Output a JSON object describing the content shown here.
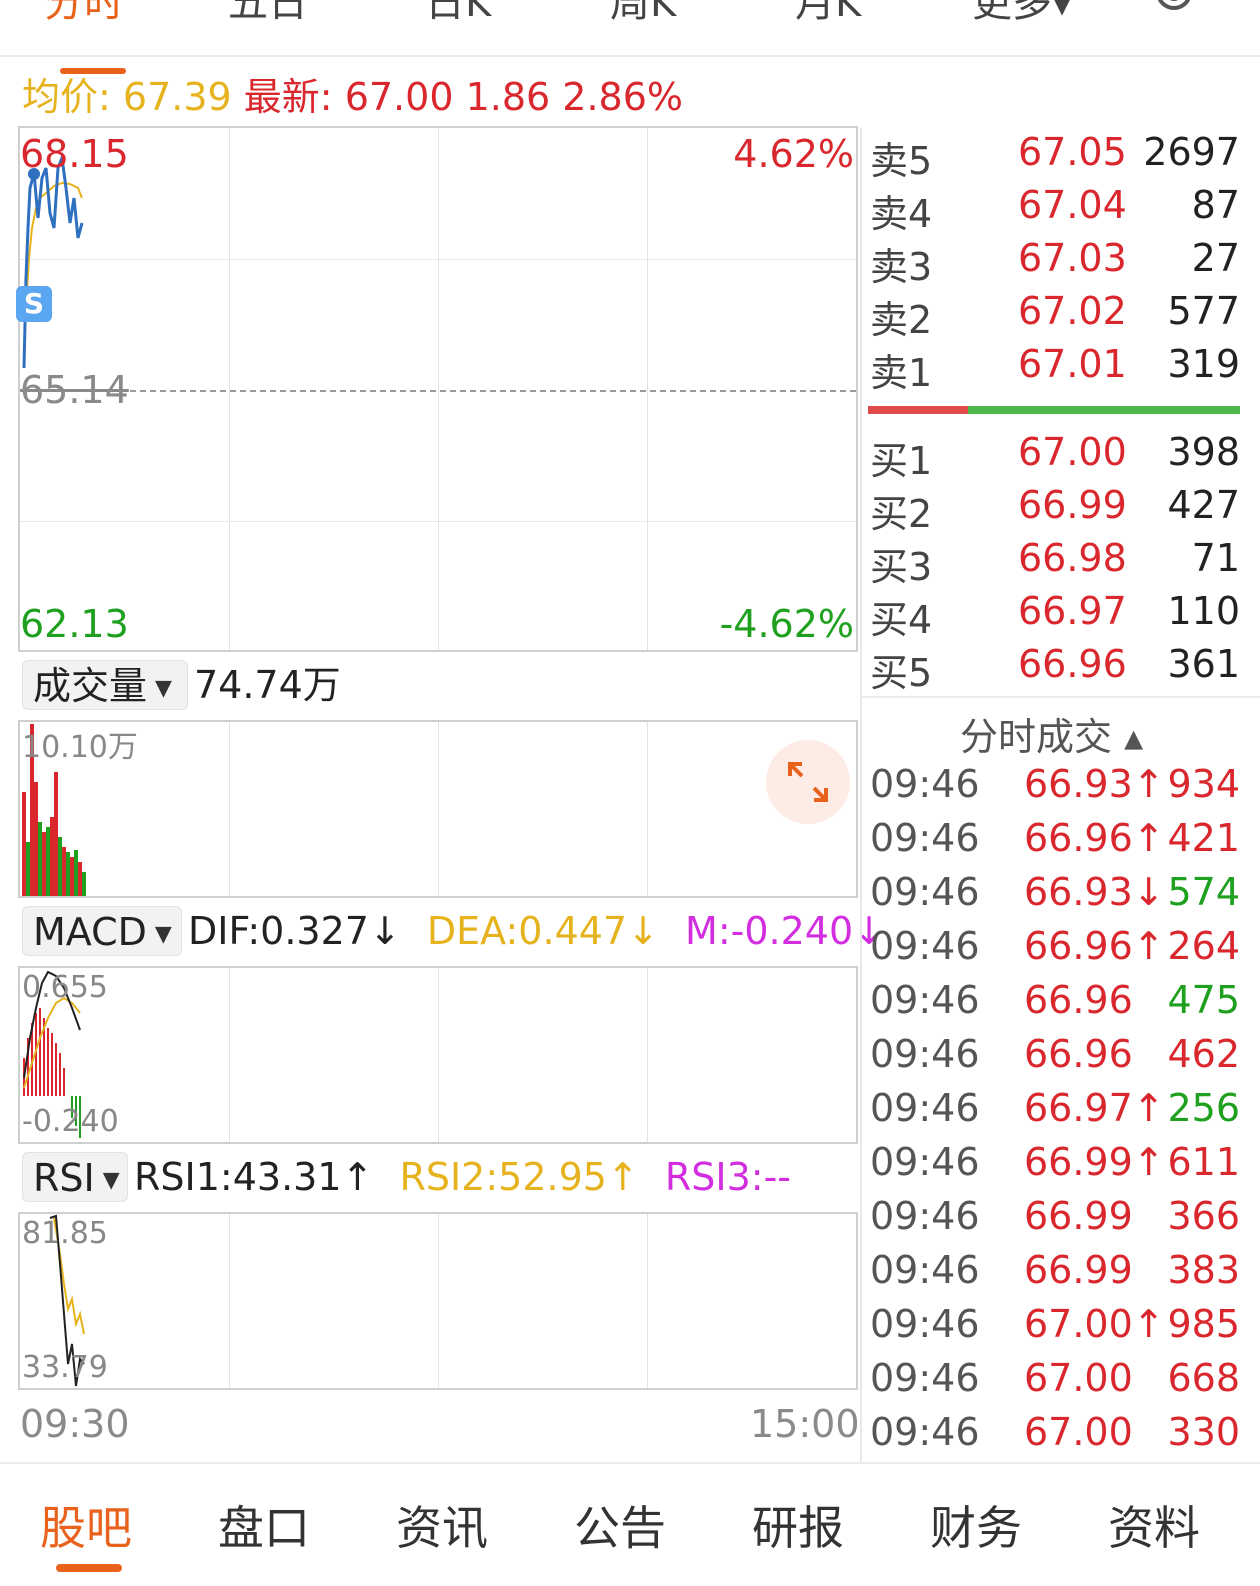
{
  "top_tabs": [
    "分时",
    "五日",
    "日K",
    "周K",
    "月K",
    "更多▾"
  ],
  "info": {
    "avg_label": "均价:",
    "avg_value": "67.39",
    "latest_label": "最新:",
    "latest_value": "67.00",
    "change": "1.86",
    "change_pct": "2.86%"
  },
  "price_chart": {
    "y_max": "68.15",
    "y_mid": "65.14",
    "y_min": "62.13",
    "pct_max": "4.62%",
    "pct_min": "-4.62%",
    "badge": "S",
    "x_start": "09:30",
    "x_end": "15:00"
  },
  "volume": {
    "selector": "成交量",
    "total": "74.74万",
    "y_max": "10.10万"
  },
  "macd": {
    "selector": "MACD",
    "dif": "DIF:0.327↓",
    "dea": "DEA:0.447↓",
    "m": "M:-0.240↓",
    "y_max": "0.655",
    "y_min": "-0.240"
  },
  "rsi": {
    "selector": "RSI",
    "rsi1": "RSI1:43.31↑",
    "rsi2": "RSI2:52.95↑",
    "rsi3": "RSI3:--",
    "y_max": "81.85",
    "y_min": "33.79"
  },
  "sell_orders": [
    {
      "label": "卖5",
      "price": "67.05",
      "volume": "2697"
    },
    {
      "label": "卖4",
      "price": "67.04",
      "volume": "87"
    },
    {
      "label": "卖3",
      "price": "67.03",
      "volume": "27"
    },
    {
      "label": "卖2",
      "price": "67.02",
      "volume": "577"
    },
    {
      "label": "卖1",
      "price": "67.01",
      "volume": "319"
    }
  ],
  "buy_orders": [
    {
      "label": "买1",
      "price": "67.00",
      "volume": "398"
    },
    {
      "label": "买2",
      "price": "66.99",
      "volume": "427"
    },
    {
      "label": "买3",
      "price": "66.98",
      "volume": "71"
    },
    {
      "label": "买4",
      "price": "66.97",
      "volume": "110"
    },
    {
      "label": "买5",
      "price": "66.96",
      "volume": "361"
    }
  ],
  "ticks_title": "分时成交 ▴",
  "ticks": [
    {
      "time": "09:46",
      "price": "66.93↑",
      "volume": "934",
      "vol_color": "red"
    },
    {
      "time": "09:46",
      "price": "66.96↑",
      "volume": "421",
      "vol_color": "red"
    },
    {
      "time": "09:46",
      "price": "66.93↓",
      "volume": "574",
      "vol_color": "green"
    },
    {
      "time": "09:46",
      "price": "66.96↑",
      "volume": "264",
      "vol_color": "red"
    },
    {
      "time": "09:46",
      "price": "66.96",
      "volume": "475",
      "vol_color": "green"
    },
    {
      "time": "09:46",
      "price": "66.96",
      "volume": "462",
      "vol_color": "red"
    },
    {
      "time": "09:46",
      "price": "66.97↑",
      "volume": "256",
      "vol_color": "green"
    },
    {
      "time": "09:46",
      "price": "66.99↑",
      "volume": "611",
      "vol_color": "red"
    },
    {
      "time": "09:46",
      "price": "66.99",
      "volume": "366",
      "vol_color": "red"
    },
    {
      "time": "09:46",
      "price": "66.99",
      "volume": "383",
      "vol_color": "red"
    },
    {
      "time": "09:46",
      "price": "67.00↑",
      "volume": "985",
      "vol_color": "red"
    },
    {
      "time": "09:46",
      "price": "67.00",
      "volume": "668",
      "vol_color": "red"
    },
    {
      "time": "09:46",
      "price": "67.00",
      "volume": "330",
      "vol_color": "red"
    }
  ],
  "bottom_tabs": [
    "股吧",
    "盘口",
    "资讯",
    "公告",
    "研报",
    "财务",
    "资料"
  ],
  "colors": {
    "accent": "#e8621c",
    "up": "#d9272d",
    "down": "#1fa01f",
    "avg": "#e6b31e",
    "magenta": "#d22ee0",
    "price_line": "#2f6fc0"
  }
}
